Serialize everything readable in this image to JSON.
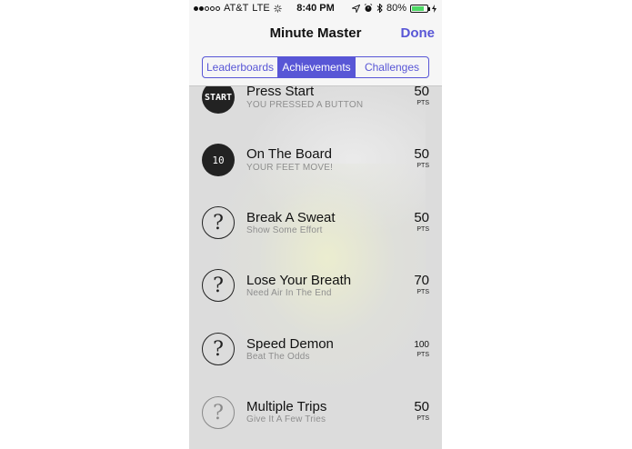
{
  "status_bar": {
    "carrier": "AT&T",
    "network": "LTE",
    "time": "8:40 PM",
    "battery": "80%"
  },
  "nav": {
    "title": "Minute Master",
    "done_label": "Done"
  },
  "segments": [
    "Leaderboards",
    "Achievements",
    "Challenges"
  ],
  "selected_segment": "Achievements",
  "pts_label": "PTS",
  "achievements": [
    {
      "title": "Press Start",
      "subtitle": "YOU PRESSED A BUTTON",
      "points": "50",
      "badge": "START",
      "state": "earned"
    },
    {
      "title": "On The Board",
      "subtitle": "YOUR FEET MOVE!",
      "points": "50",
      "badge": "10",
      "state": "earned"
    },
    {
      "title": "Break A Sweat",
      "subtitle": "Show Some Effort",
      "points": "50",
      "badge": "?",
      "state": "locked"
    },
    {
      "title": "Lose Your Breath",
      "subtitle": "Need Air In The End",
      "points": "70",
      "badge": "?",
      "state": "locked"
    },
    {
      "title": "Speed Demon",
      "subtitle": "Beat The Odds",
      "points": "100",
      "badge": "?",
      "state": "locked"
    },
    {
      "title": "Multiple Trips",
      "subtitle": "Give It A Few Tries",
      "points": "50",
      "badge": "?",
      "state": "locked"
    }
  ],
  "icons": {
    "location": "location-arrow-icon",
    "alarm": "alarm-icon",
    "bluetooth": "bluetooth-icon",
    "battery": "battery-icon",
    "charging": "charging-bolt-icon"
  },
  "colors": {
    "accent": "#5856d6",
    "battery_fill": "#4cd964",
    "badge_earned": "#222222",
    "subtitle": "#8e8e8e"
  }
}
